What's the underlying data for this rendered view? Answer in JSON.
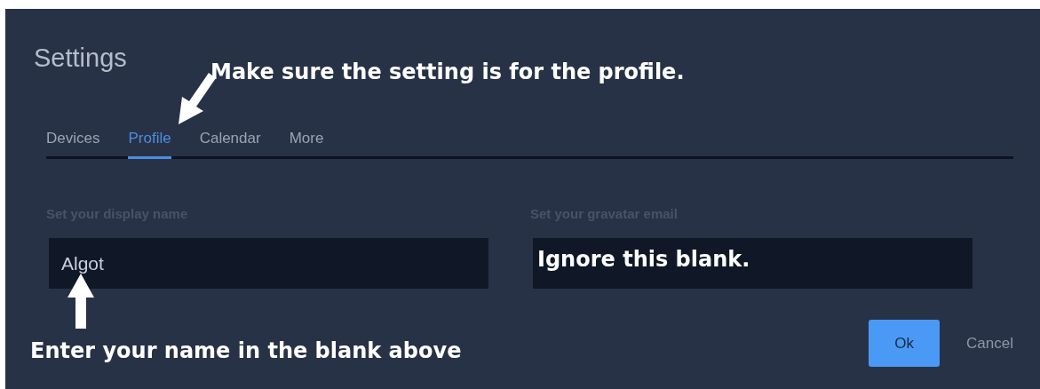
{
  "window": {
    "title": "Settings"
  },
  "tabs": [
    {
      "label": "Devices",
      "selected": false
    },
    {
      "label": "Profile",
      "selected": true
    },
    {
      "label": "Calendar",
      "selected": false
    },
    {
      "label": "More",
      "selected": false
    }
  ],
  "fields": [
    {
      "label": "Set your display name",
      "value": "Algot"
    },
    {
      "label": "Set your gravatar email"
    }
  ],
  "buttons": [
    {
      "label": "Ok",
      "kind": "primary"
    },
    {
      "label": "Cancel",
      "kind": "plain"
    }
  ],
  "annotations": [
    {
      "text": "Make sure the setting is for the profile.",
      "kind": "tab"
    },
    {
      "text": "Ignore this blank.",
      "kind": "field"
    },
    {
      "text": "Enter your name in the blank above",
      "kind": "name"
    }
  ]
}
